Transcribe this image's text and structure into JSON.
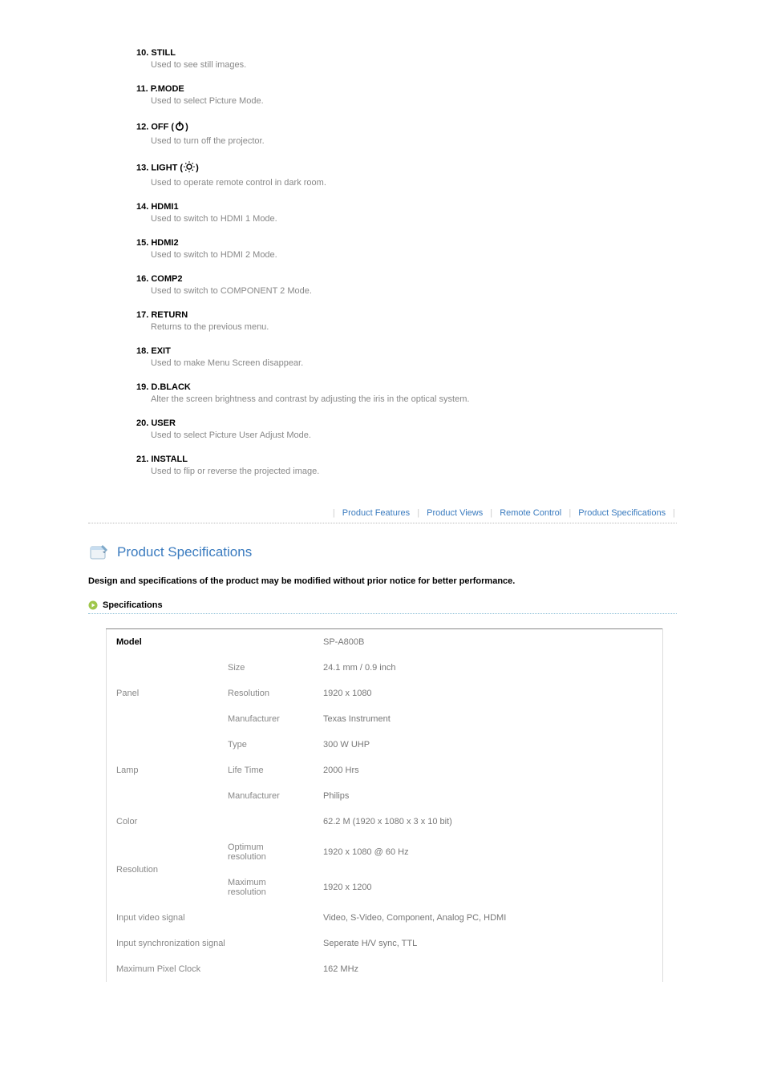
{
  "remote": [
    {
      "num": "10.",
      "title": "STILL",
      "desc": "Used to see still images.",
      "icon": null
    },
    {
      "num": "11.",
      "title": "P.MODE",
      "desc": "Used to select Picture Mode.",
      "icon": null
    },
    {
      "num": "12.",
      "title": "OFF (",
      "title_close": ")",
      "desc": "Used to turn off the projector.",
      "icon": "power"
    },
    {
      "num": "13.",
      "title": "LIGHT (",
      "title_close": ")",
      "desc": "Used to operate remote control in dark room.",
      "icon": "light"
    },
    {
      "num": "14.",
      "title": "HDMI1",
      "desc": "Used to switch to HDMI 1 Mode.",
      "icon": null
    },
    {
      "num": "15.",
      "title": "HDMI2",
      "desc": "Used to switch to HDMI 2 Mode.",
      "icon": null
    },
    {
      "num": "16.",
      "title": "COMP2",
      "desc": "Used to switch to COMPONENT 2 Mode.",
      "icon": null
    },
    {
      "num": "17.",
      "title": "RETURN",
      "desc": "Returns to the previous menu.",
      "icon": null
    },
    {
      "num": "18.",
      "title": "EXIT",
      "desc": "Used to make Menu Screen disappear.",
      "icon": null
    },
    {
      "num": "19.",
      "title": "D.BLACK",
      "desc": "Alter the screen brightness and contrast by adjusting the iris in the optical system.",
      "icon": null
    },
    {
      "num": "20.",
      "title": "USER",
      "desc": "Used to select Picture User Adjust Mode.",
      "icon": null
    },
    {
      "num": "21.",
      "title": "INSTALL",
      "desc": "Used to flip or reverse the projected image.",
      "icon": null
    }
  ],
  "nav": {
    "features": "Product Features",
    "views": "Product Views",
    "remote": "Remote Control",
    "specs": "Product Specifications"
  },
  "section_title": "Product Specifications",
  "design_note": "Design and specifications of the product may be modified without prior notice for better performance.",
  "sub_header": "Specifications",
  "spec_table": {
    "model_label": "Model",
    "model_value": "SP-A800B",
    "panel_label": "Panel",
    "panel_size_label": "Size",
    "panel_size_value": "24.1 mm / 0.9 inch",
    "panel_res_label": "Resolution",
    "panel_res_value": "1920 x 1080",
    "panel_mfr_label": "Manufacturer",
    "panel_mfr_value": "Texas Instrument",
    "lamp_label": "Lamp",
    "lamp_type_label": "Type",
    "lamp_type_value": "300 W UHP",
    "lamp_life_label": "Life Time",
    "lamp_life_value": "2000 Hrs",
    "lamp_mfr_label": "Manufacturer",
    "lamp_mfr_value": "Philips",
    "color_label": "Color",
    "color_value": "62.2 M (1920 x 1080 x 3 x 10 bit)",
    "res_label": "Resolution",
    "res_opt_label": "Optimum resolution",
    "res_opt_value": "1920 x 1080 @ 60 Hz",
    "res_max_label": "Maximum resolution",
    "res_max_value": "1920 x 1200",
    "ivs_label": "Input video signal",
    "ivs_value": "Video, S-Video, Component, Analog PC, HDMI",
    "iss_label": "Input synchronization signal",
    "iss_value": "Seperate H/V sync, TTL",
    "mpc_label": "Maximum Pixel Clock",
    "mpc_value": "162 MHz"
  }
}
